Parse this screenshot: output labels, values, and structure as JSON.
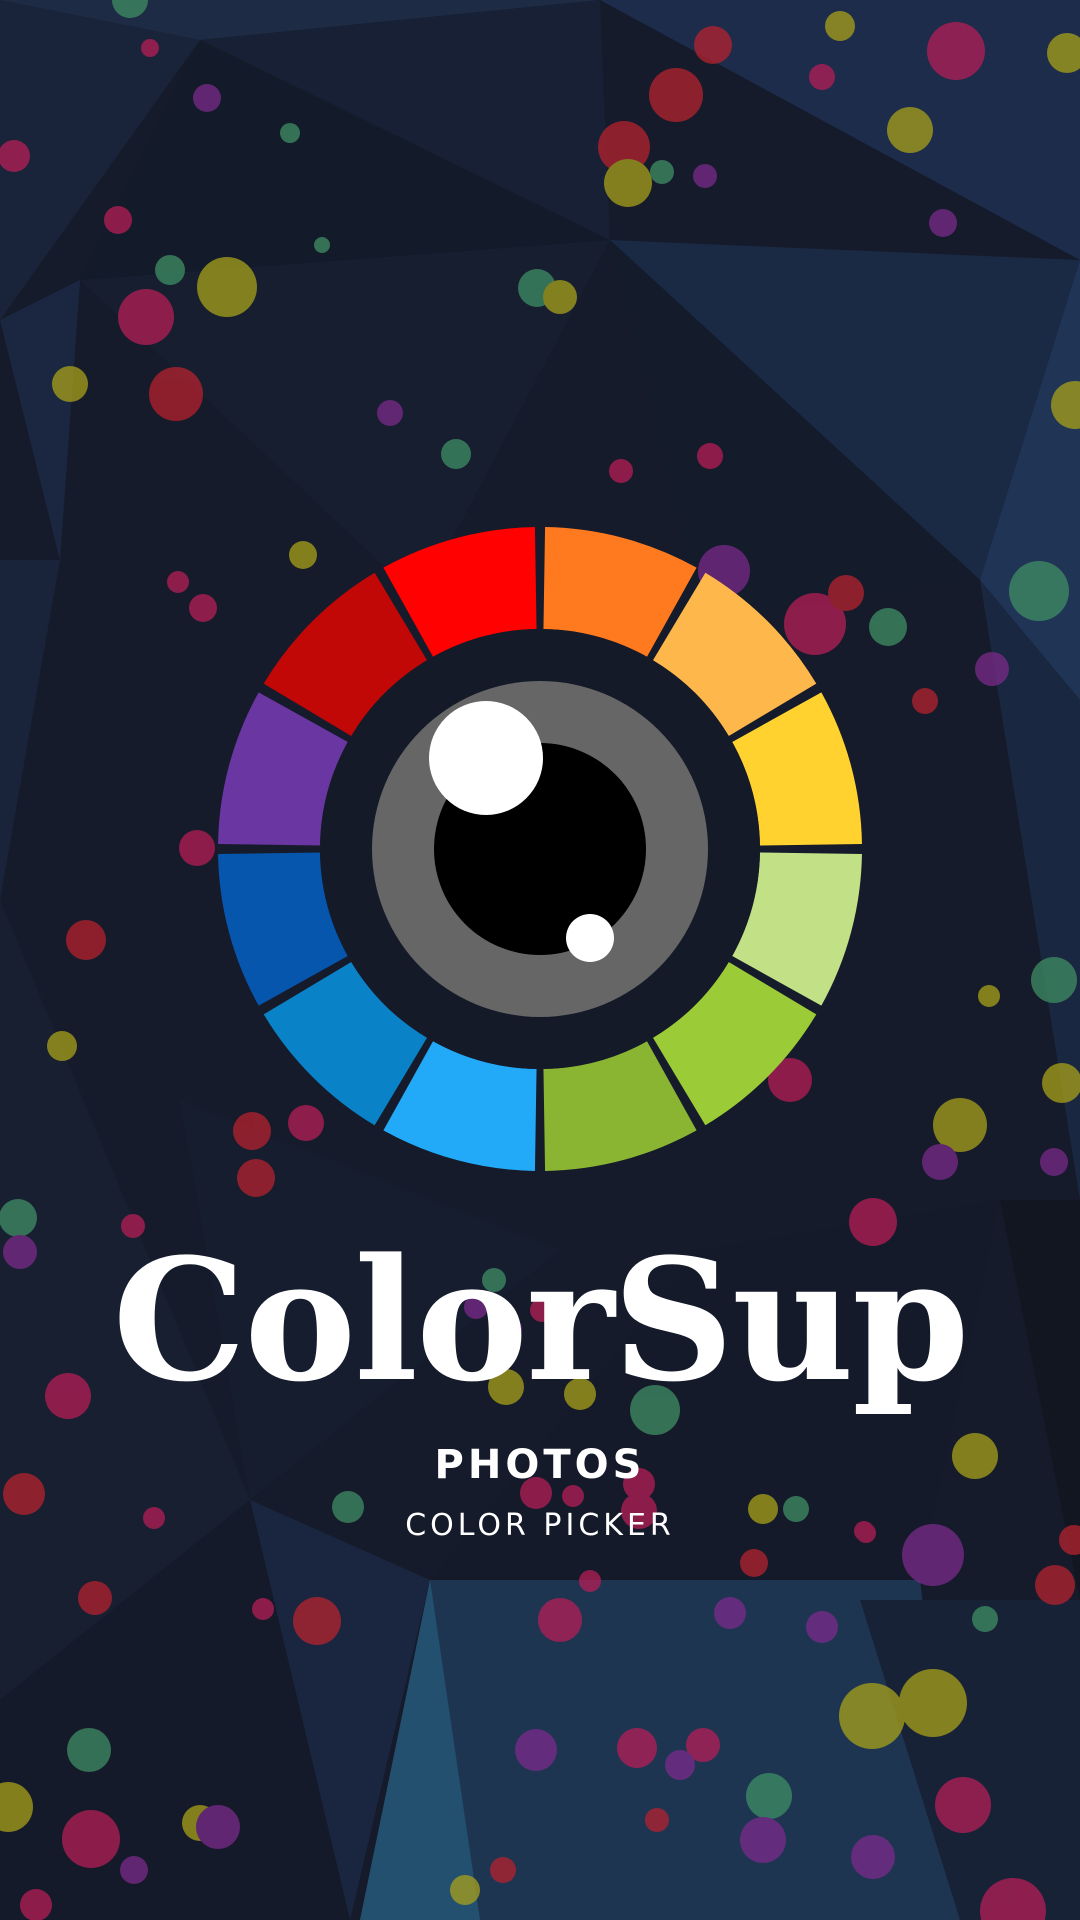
{
  "splash": {
    "app_name": "ColorSup",
    "line1": "PHOTOS",
    "line2": "COLOR PICKER"
  },
  "logo": {
    "icon": "color-wheel-eye-icon",
    "segment_colors": [
      "#FF7A1F",
      "#FDB74B",
      "#FFD22F",
      "#C2E085",
      "#9BCB36",
      "#8AB533",
      "#22AAF8",
      "#0A82C8",
      "#0756AE",
      "#6A36A1",
      "#C20707",
      "#FF0101"
    ],
    "iris_color": "#666666",
    "pupil_color": "#000000",
    "highlight_color": "#FFFFFF"
  },
  "theme": {
    "background": "#151B2A",
    "facet_light": "#1E2D4A",
    "facet_cyan": "#23506F",
    "dot_colors": [
      "#B51E56",
      "#A8A11A",
      "#3F8E64",
      "#7A2A8A",
      "#B5222E"
    ]
  }
}
